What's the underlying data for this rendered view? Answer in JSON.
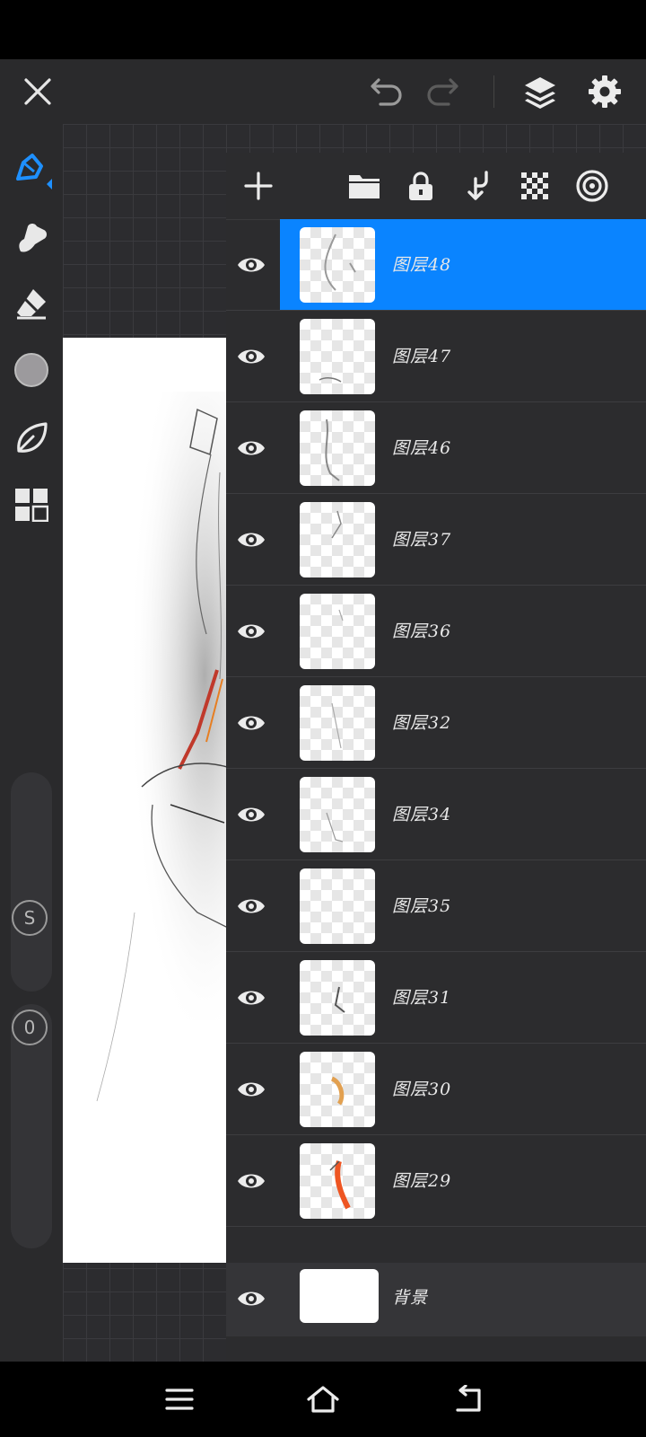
{
  "toolbar": {
    "close_icon": "close-icon",
    "undo_icon": "undo-icon",
    "redo_icon": "redo-icon",
    "layers_icon": "layers-icon",
    "settings_icon": "gear-icon"
  },
  "tools": [
    "brush-icon",
    "smudge-icon",
    "eraser-icon",
    "color-icon",
    "leaf-icon",
    "grid-icon"
  ],
  "side_sliders": {
    "size_label": "S",
    "opacity_label": "0"
  },
  "layers_panel": {
    "actions": [
      "add-icon",
      "folder-icon",
      "lock-icon",
      "merge-down-icon",
      "transparency-icon",
      "target-icon"
    ],
    "layers": [
      {
        "name": "图层48",
        "selected": true
      },
      {
        "name": "图层47",
        "selected": false
      },
      {
        "name": "图层46",
        "selected": false
      },
      {
        "name": "图层37",
        "selected": false
      },
      {
        "name": "图层36",
        "selected": false
      },
      {
        "name": "图层32",
        "selected": false
      },
      {
        "name": "图层34",
        "selected": false
      },
      {
        "name": "图层35",
        "selected": false
      },
      {
        "name": "图层31",
        "selected": false
      },
      {
        "name": "图层30",
        "selected": false
      },
      {
        "name": "图层29",
        "selected": false
      }
    ],
    "background_layer": {
      "name": "背景"
    }
  },
  "colors": {
    "accent": "#0a84ff",
    "panel": "#2c2c2e",
    "tool_active": "#1e90ff"
  }
}
